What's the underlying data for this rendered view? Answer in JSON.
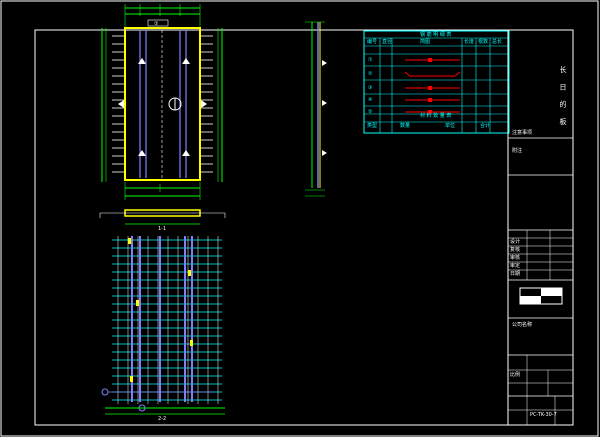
{
  "colors": {
    "background": "#000000",
    "frame": "#ffffff",
    "outline_yellow": "#ffff00",
    "dim_green": "#00ff00",
    "grid_cyan": "#00ffff",
    "rebar_purple": "#8080ff",
    "mark_red": "#ff0000",
    "text_white": "#ffffff"
  },
  "title_block": {
    "side_title": "长 日 的 板",
    "header_note": "注意事项",
    "remark_label": "附注",
    "company_label": "公司名称",
    "drawing_no": "PC-TK-30-7",
    "rows": [
      "设计",
      "复核",
      "审核",
      "审定",
      "日期",
      "比例"
    ]
  },
  "schedule": {
    "title": "钢 筋 明 细 表",
    "headers": [
      "编号",
      "直径",
      "简图",
      "长度",
      "根数",
      "总长"
    ],
    "rows": [
      "①",
      "②",
      "③",
      "④",
      "⑤"
    ],
    "summary_title": "材 料 数 量 表",
    "summary_headers": [
      "类型",
      "数量",
      "单位",
      "合计"
    ]
  },
  "views": {
    "plan_marker": "①",
    "section_label": "1-1",
    "bottom_label": "2-2"
  }
}
